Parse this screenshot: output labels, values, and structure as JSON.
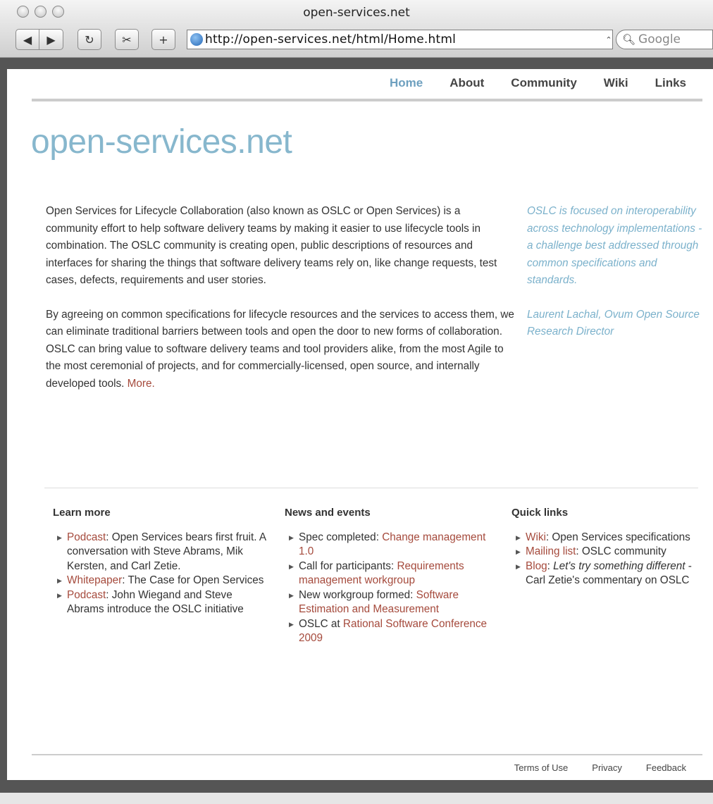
{
  "browser": {
    "window_title": "open-services.net",
    "url": "http://open-services.net/html/Home.html",
    "search_placeholder": "Google"
  },
  "nav": {
    "items": [
      {
        "label": "Home",
        "active": true
      },
      {
        "label": "About"
      },
      {
        "label": "Community"
      },
      {
        "label": "Wiki"
      },
      {
        "label": "Links"
      }
    ]
  },
  "site_title": "open-services.net",
  "intro": {
    "p1": "Open Services for Lifecycle Collaboration (also known as OSLC or Open Services) is a community effort to help software delivery teams by making it easier to use lifecycle tools in combination. The OSLC community is creating open, public descriptions of resources and interfaces for sharing the things that software delivery teams rely on, like change requests, test cases, defects, requirements and user stories.",
    "p2": "By agreeing on common specifications for lifecycle resources and the services to access them, we can eliminate traditional barriers between tools and open the door to new forms of collaboration. OSLC can bring value to software delivery teams and tool providers alike, from the most Agile to the most ceremonial of projects, and for commercially-licensed, open source, and internally developed tools.",
    "more_link": "More."
  },
  "quote": {
    "text": "OSLC is focused on interoperability across technology implementations - a challenge best addressed through common specifications and standards.",
    "attribution": "Laurent Lachal, Ovum Open Source Research Director"
  },
  "learn_more": {
    "heading": "Learn more",
    "items": [
      {
        "link": "Podcast",
        "text": ": Open Services bears first fruit. A conversation with Steve Abrams, Mik Kersten, and Carl Zetie."
      },
      {
        "link": "Whitepaper",
        "text": ": The Case for Open Services"
      },
      {
        "link": "Podcast",
        "text": ": John Wiegand and Steve Abrams introduce the OSLC initiative"
      }
    ]
  },
  "news": {
    "heading": "News and events",
    "items": [
      {
        "text": "Spec completed: ",
        "link": "Change management 1.0"
      },
      {
        "text": "Call for participants: ",
        "link": "Requirements management workgroup"
      },
      {
        "text": "New workgroup formed: ",
        "link": "Software Estimation and Measurement"
      },
      {
        "text": "OSLC at ",
        "link": "Rational Software Conference 2009"
      }
    ]
  },
  "quick_links": {
    "heading": "Quick links",
    "items": [
      {
        "link": "Wiki",
        "text": ": Open Services specifications"
      },
      {
        "link": "Mailing list",
        "text": ": OSLC community"
      },
      {
        "link": "Blog",
        "text_em": "Let's try something different",
        "text": " - Carl Zetie's commentary on OSLC"
      }
    ]
  },
  "footer": {
    "terms": "Terms of Use",
    "privacy": "Privacy",
    "feedback": "Feedback"
  },
  "icons": {
    "back": "back-arrow-icon",
    "forward": "forward-arrow-icon",
    "reload": "reload-icon",
    "snip": "scissors-icon",
    "add": "plus-icon",
    "site": "globe-icon",
    "search": "magnifier-icon"
  },
  "colors": {
    "accent_blue": "#87b7cd",
    "link_red": "#a54a3c",
    "nav_active": "#6ea0bf"
  }
}
